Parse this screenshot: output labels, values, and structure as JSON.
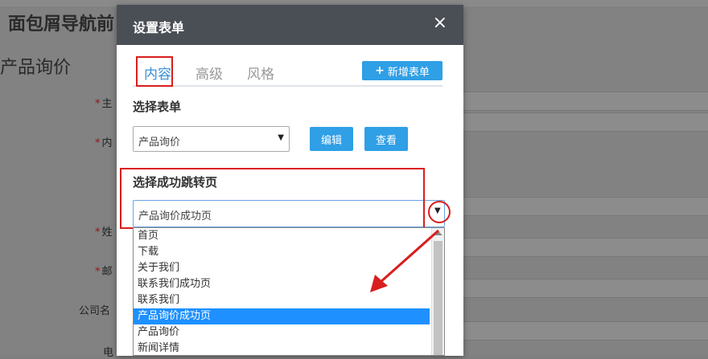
{
  "background": {
    "page_title": "面包屑导航前",
    "section_title": "产品询价",
    "fields": [
      {
        "label": "主",
        "required": true
      },
      {
        "label": "内",
        "required": true
      },
      {
        "label": "姓",
        "required": true
      },
      {
        "label": "邮",
        "required": true
      },
      {
        "label": "公司名",
        "required": false
      },
      {
        "label": "电",
        "required": false
      }
    ]
  },
  "modal": {
    "title": "设置表单",
    "close_glyph": "×",
    "tabs": [
      {
        "label": "内容",
        "active": true
      },
      {
        "label": "高级",
        "active": false
      },
      {
        "label": "风格",
        "active": false
      }
    ],
    "new_form_button": "新增表单",
    "new_form_icon": "+",
    "select_form_label": "选择表单",
    "form_select": {
      "value": "产品询价"
    },
    "edit_button": "编辑",
    "view_button": "查看",
    "redirect_label": "选择成功跳转页",
    "redirect_select": {
      "value": "产品询价成功页"
    }
  },
  "dropdown": {
    "options": [
      "首页",
      "下载",
      "关于我们",
      "联系我们成功页",
      "联系我们",
      "产品询价成功页",
      "产品询价",
      "新闻详情"
    ],
    "selected_index": 5
  },
  "colors": {
    "accent": "#2f9fe6",
    "header": "#4a4e55",
    "annotation": "#d81e1e",
    "selection": "#1e90ff"
  }
}
